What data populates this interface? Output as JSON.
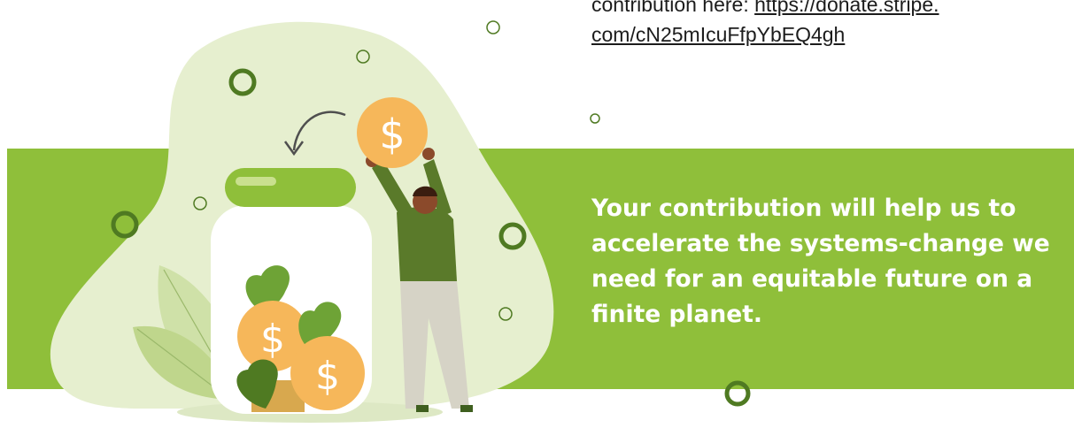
{
  "top_text": {
    "prefix": "contribution here: ",
    "link_line1": "https://donate.stripe.",
    "link_line2": "com/cN25mIcuFfpYbEQ4gh"
  },
  "tagline": "Your contribution will help us to accelerate the systems-change we need for an equitable future on a finite planet.",
  "coin_symbol": "$",
  "colors": {
    "band_green": "#8fbf3a",
    "blob_green": "#e6efcf",
    "dark_green": "#4f7a22",
    "coin_orange": "#f6b75a",
    "skin": "#8b4a2b",
    "shirt": "#5a7a2a",
    "pants": "#d6d3c6"
  }
}
